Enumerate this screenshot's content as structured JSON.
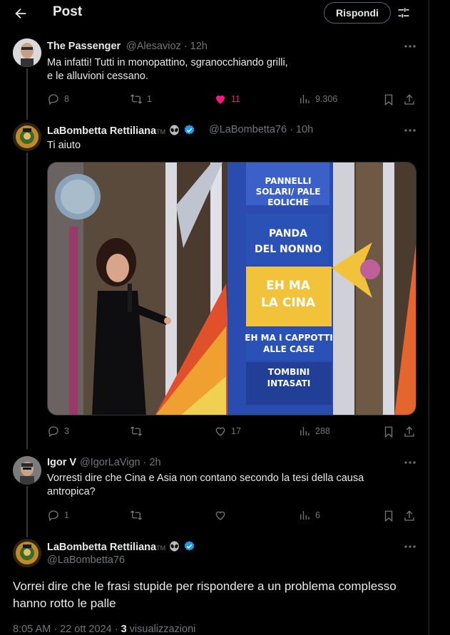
{
  "header": {
    "title": "Post",
    "reply_button": "Rispondi"
  },
  "tweets": [
    {
      "name": "The Passenger",
      "handle": "@Alesavioz",
      "time": "12h",
      "text_lines": [
        "Ma infatti! Tutti in monopattino, sgranocchiando grilli,",
        "e le alluvioni cessano."
      ],
      "replies": "8",
      "reposts": "1",
      "likes": "11",
      "views": "9.306"
    },
    {
      "name": "LaBombetta Rettiliana",
      "tm": "TM",
      "handle": "@LaBombetta76",
      "time": "10h",
      "text": "Ti aiuto",
      "replies": "3",
      "reposts": "",
      "likes": "17",
      "views": "288",
      "media": {
        "labels": [
          [
            "PANNELLI",
            "SOLARI/ PALE",
            "EOLICHE"
          ],
          [
            "PANDA",
            "DEL NONNO"
          ],
          [
            "EH MA",
            "LA CINA"
          ],
          [
            "EH MA I CAPPOTTI",
            "ALLE CASE"
          ],
          [
            "TOMBINI",
            "INTASATI"
          ]
        ]
      }
    },
    {
      "name": "Igor V",
      "handle": "@IgorLaVign",
      "time": "2h",
      "text_lines": [
        "Vorresti dire che Cina e Asia non contano secondo la tesi della causa",
        "antropica?"
      ],
      "replies": "1",
      "reposts": "",
      "likes": "",
      "views": "6"
    }
  ],
  "main": {
    "name": "LaBombetta Rettiliana",
    "tm": "TM",
    "handle": "@LaBombetta76",
    "text_lines": [
      "Vorrei dire che le frasi stupide per rispondere a un problema complesso",
      "hanno rotto le palle"
    ],
    "time": "8:05 AM",
    "date": "22 ott 2024",
    "views_count": "3",
    "views_label": "visualizzazioni"
  },
  "colors": {
    "accent": "#1d9bf0",
    "like": "#f91880",
    "muted": "#71767b",
    "text": "#e7e9ea"
  }
}
